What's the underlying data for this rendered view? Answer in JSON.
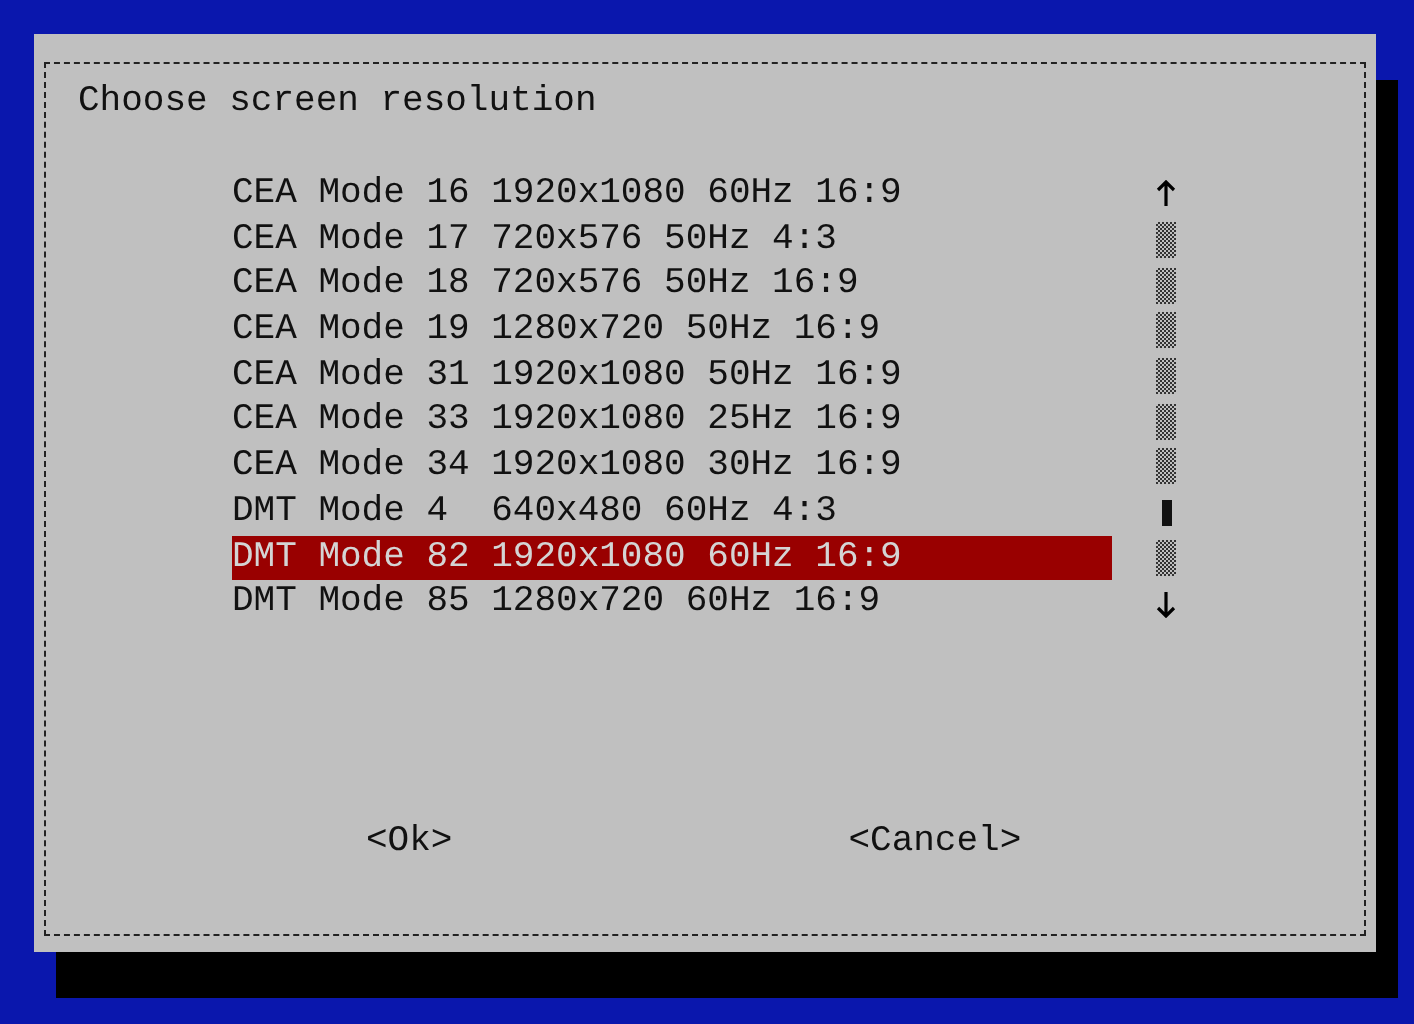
{
  "dialog": {
    "title": "Choose screen resolution",
    "items": [
      {
        "label": "CEA Mode 16 1920x1080 60Hz 16:9",
        "selected": false
      },
      {
        "label": "CEA Mode 17 720x576 50Hz 4:3",
        "selected": false
      },
      {
        "label": "CEA Mode 18 720x576 50Hz 16:9",
        "selected": false
      },
      {
        "label": "CEA Mode 19 1280x720 50Hz 16:9",
        "selected": false
      },
      {
        "label": "CEA Mode 31 1920x1080 50Hz 16:9",
        "selected": false
      },
      {
        "label": "CEA Mode 33 1920x1080 25Hz 16:9",
        "selected": false
      },
      {
        "label": "CEA Mode 34 1920x1080 30Hz 16:9",
        "selected": false
      },
      {
        "label": "DMT Mode 4  640x480 60Hz 4:3",
        "selected": false
      },
      {
        "label": "DMT Mode 82 1920x1080 60Hz 16:9",
        "selected": true
      },
      {
        "label": "DMT Mode 85 1280x720 60Hz 16:9",
        "selected": false
      }
    ],
    "buttons": [
      {
        "label": "<Ok>"
      },
      {
        "label": "<Cancel>"
      }
    ]
  }
}
